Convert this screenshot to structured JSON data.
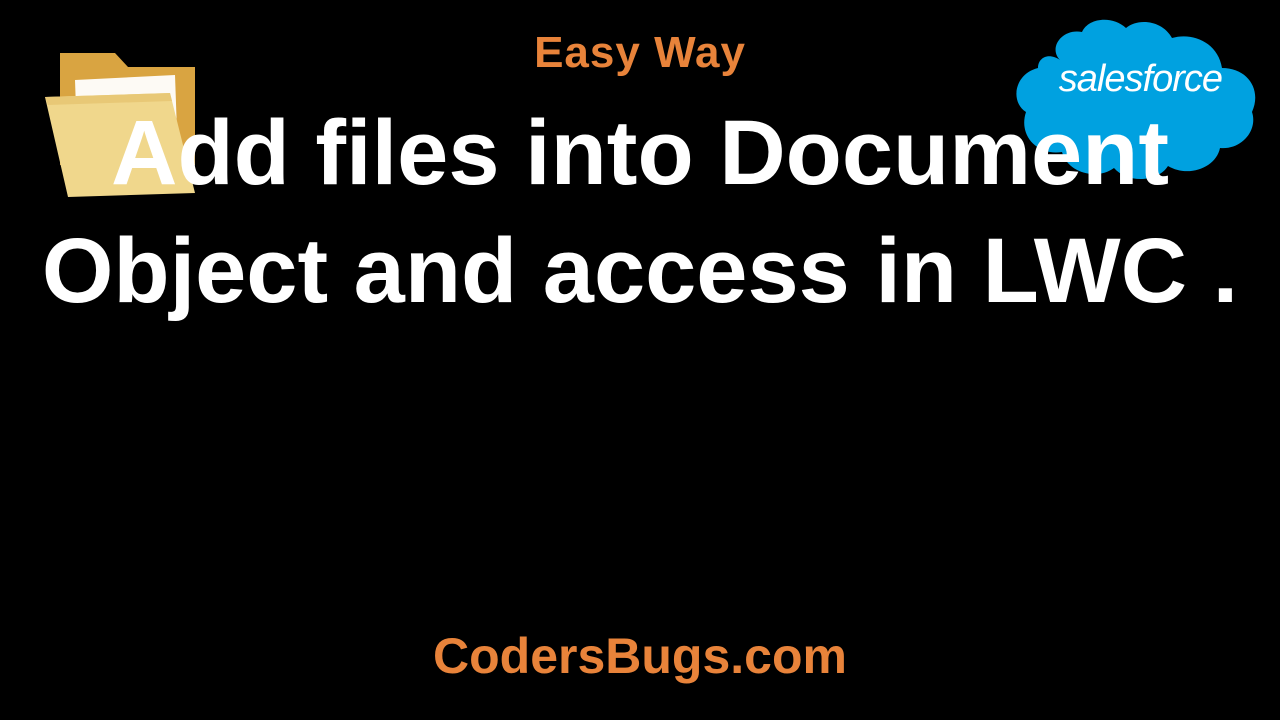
{
  "subtitle": "Easy Way",
  "mainTitle": "Add files into Document Object and access in LWC .",
  "website": "CodersBugs.com",
  "salesforce": {
    "textBold": "sales",
    "textLight": "force"
  },
  "colors": {
    "accent": "#e8833a",
    "text": "#ffffff",
    "background": "#000000",
    "cloud": "#00a1e0",
    "folderLight": "#f0d78c",
    "folderDark": "#d9a441"
  }
}
